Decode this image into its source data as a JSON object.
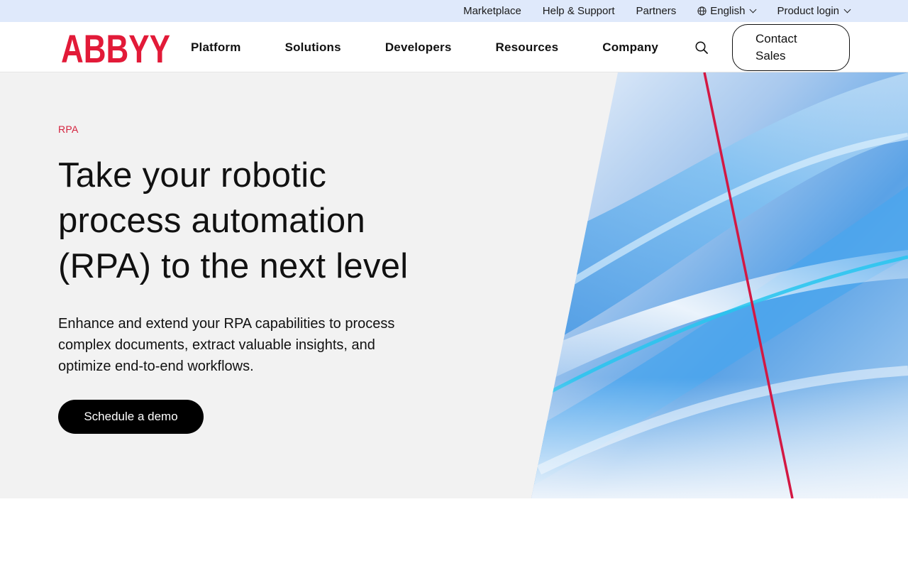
{
  "utility_nav": {
    "items": [
      "Marketplace",
      "Help & Support",
      "Partners"
    ],
    "language": "English",
    "product_login": "Product login"
  },
  "brand": {
    "logo_text": "ABBYY",
    "color": "#e21a38"
  },
  "main_nav": {
    "items": [
      "Platform",
      "Solutions",
      "Developers",
      "Resources",
      "Company"
    ],
    "contact_line1": "Contact",
    "contact_line2": "Sales"
  },
  "hero": {
    "eyebrow": "RPA",
    "title_lines": [
      "Take your robotic",
      "process automation",
      "(RPA) to the next level"
    ],
    "subtitle_lines": [
      "Enhance and extend your RPA capabilities to process",
      "complex documents, extract valuable insights, and",
      "optimize end-to-end workflows."
    ],
    "cta": "Schedule a demo"
  },
  "colors": {
    "utility_bg": "#dfe9fb",
    "accent_red": "#d4213d",
    "hero_bg": "#f2f2f2",
    "cta_bg": "#000000"
  },
  "icons": {
    "search": "search-icon",
    "globe": "globe-icon",
    "chevron": "chevron-down-icon"
  }
}
